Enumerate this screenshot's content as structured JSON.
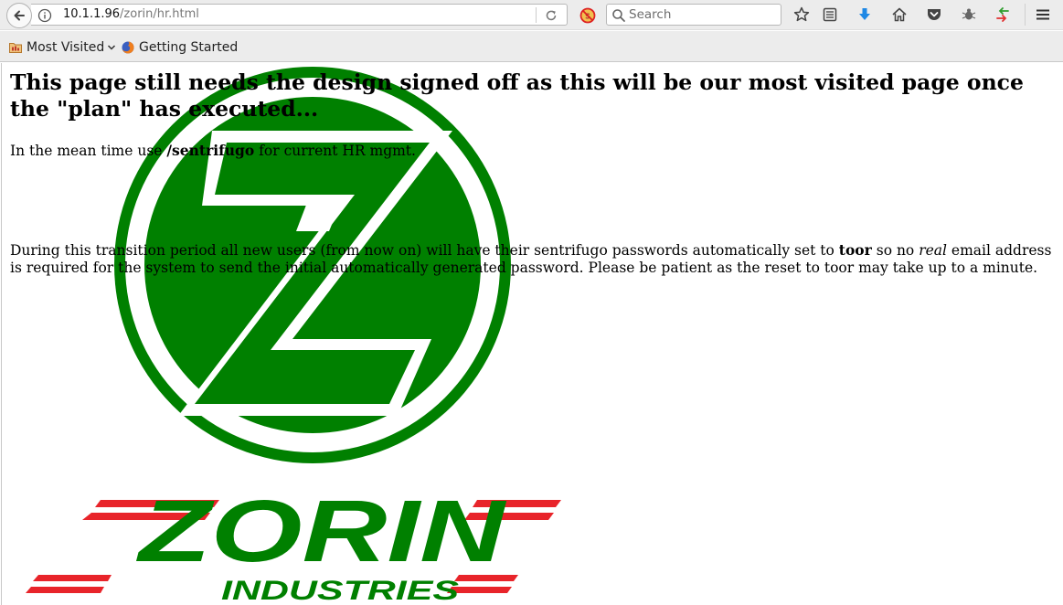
{
  "browser": {
    "url_host": "10.1.1.96",
    "url_path": "/zorin/hr.html",
    "search_placeholder": "Search"
  },
  "bookmarks": {
    "most_visited_label": "Most Visited",
    "getting_started_label": "Getting Started"
  },
  "page": {
    "heading": "This page still needs the design signed off as this will be our most visited page once the \"plan\" has executed...",
    "p1": {
      "before": "In the mean time use ",
      "bold": "/sentrifugo",
      "after": " for current HR mgmt."
    },
    "p2": {
      "before": "During this transition period all new users (from now on) will have their sentrifugo passwords automatically set to ",
      "bold": "toor",
      "middle": " so no ",
      "italic": "real",
      "after": " email address is required for the system to send the initial automatically generated password. Please be patient as the reset to toor may take up to a minute."
    },
    "logo": {
      "wordmark": "ZORIN",
      "subtitle": "INDUSTRIES"
    }
  },
  "colors": {
    "logo_green": "#008000",
    "logo_red": "#e8242a"
  }
}
